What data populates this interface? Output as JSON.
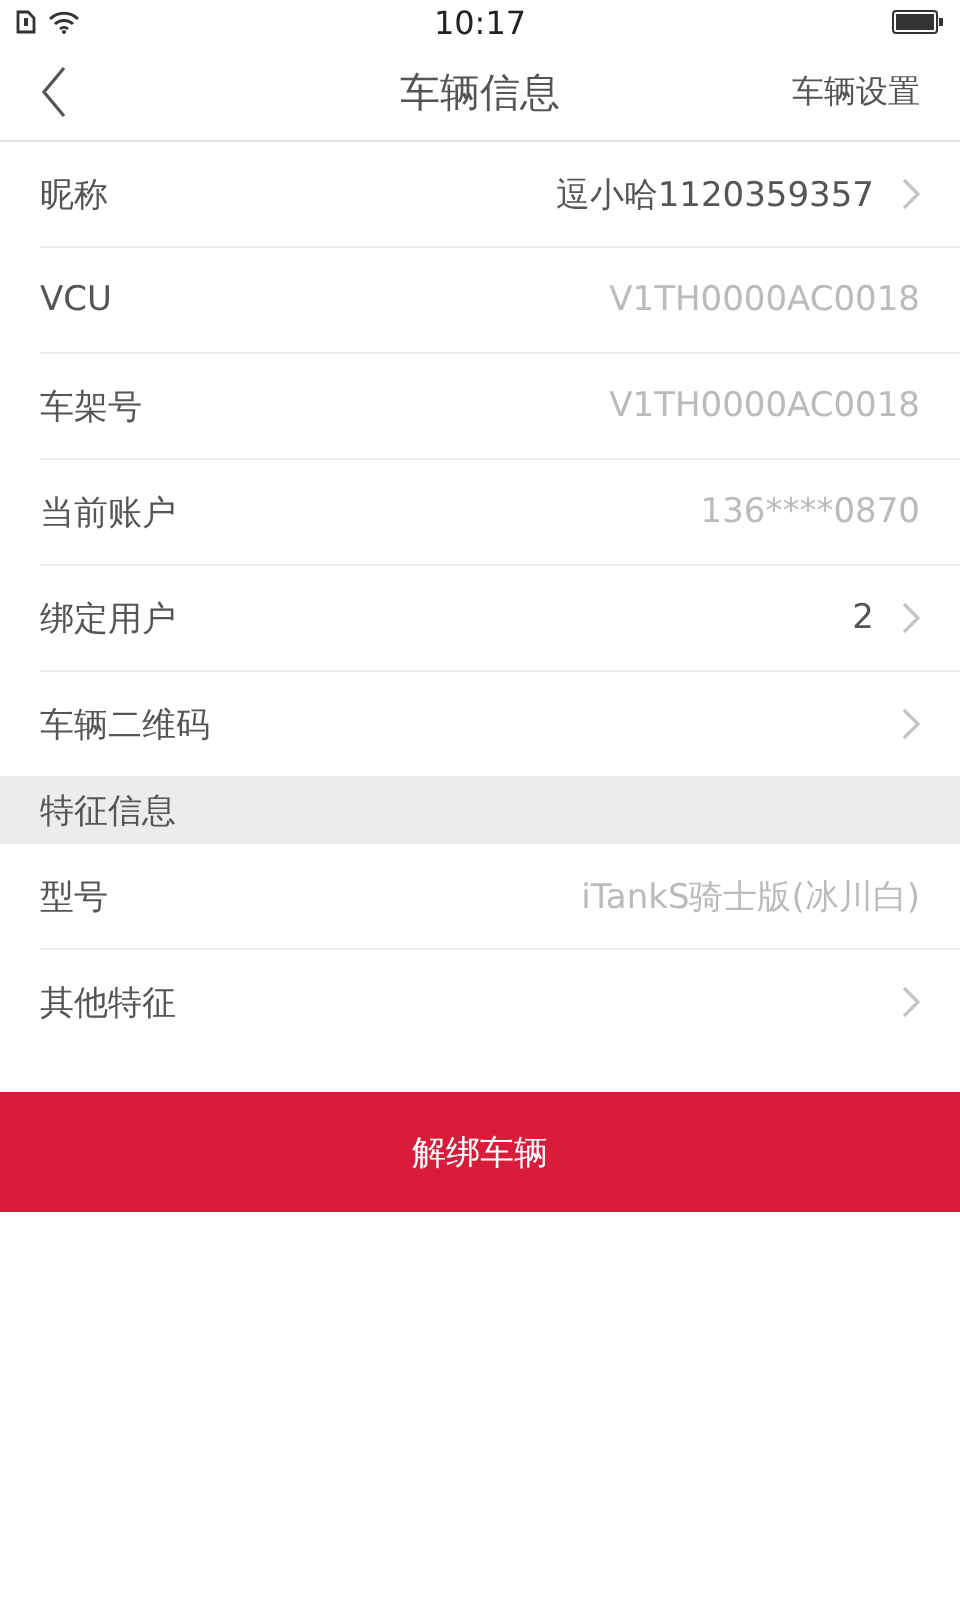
{
  "status_bar": {
    "time": "10:17"
  },
  "nav": {
    "title": "车辆信息",
    "action": "车辆设置"
  },
  "sections": [
    {
      "rows": [
        {
          "label": "昵称",
          "value": "逗小哈1120359357",
          "kind": "link"
        },
        {
          "label": "VCU",
          "value": "V1TH0000AC0018",
          "kind": "info"
        },
        {
          "label": "车架号",
          "value": "V1TH0000AC0018",
          "kind": "info"
        },
        {
          "label": "当前账户",
          "value": "136****0870",
          "kind": "info"
        },
        {
          "label": "绑定用户",
          "value": "2",
          "kind": "link"
        },
        {
          "label": "车辆二维码",
          "kind": "link"
        }
      ]
    },
    {
      "header": "特征信息",
      "rows": [
        {
          "label": "型号",
          "value": "iTankS骑士版(冰川白)",
          "kind": "info"
        },
        {
          "label": "其他特征",
          "kind": "link"
        }
      ]
    }
  ],
  "unbind_button": "解绑车辆"
}
